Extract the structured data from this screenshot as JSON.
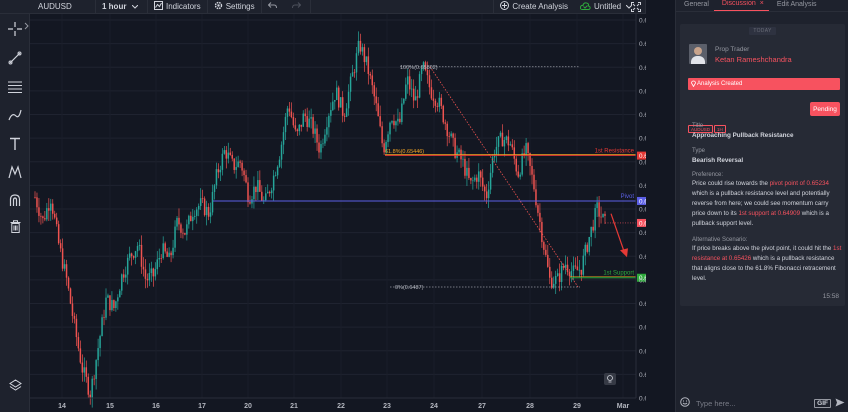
{
  "toolbar": {
    "symbol": "AUDUSD",
    "interval": "1 hour",
    "indicators": "Indicators",
    "settings": "Settings",
    "create_analysis": "Create Analysis",
    "untitled": "Untitled"
  },
  "panel": {
    "tabs": [
      "General",
      "Discussion",
      "Edit Analysis"
    ],
    "active_tab": "Discussion",
    "today": "TODAY",
    "role": "Prop Trader",
    "author": "Ketan Rameshchandra",
    "status_banner": "Analysis Created",
    "tags": [
      "AUDUSD",
      "1H"
    ],
    "status": "Pending",
    "title_label": "Title",
    "title": "Approaching Pullback Resistance",
    "type_label": "Type",
    "type": "Bearish Reversal",
    "preference_label": "Preference:",
    "preference": [
      {
        "t": "Price could rise towards the ",
        "hl": false
      },
      {
        "t": "pivot point of 0.65234",
        "hl": true
      },
      {
        "t": " which is a pullback resistance level and potentially reverse from here; we could see momentum carry price down to its ",
        "hl": false
      },
      {
        "t": "1st support at 0.64909",
        "hl": true
      },
      {
        "t": " which is a pullback support level.",
        "hl": false
      }
    ],
    "alternative_label": "Alternative Scenario:",
    "alternative": [
      {
        "t": "If price breaks above the pivot point, it could hit the ",
        "hl": false
      },
      {
        "t": "1st resistance at 0.65426",
        "hl": true
      },
      {
        "t": " which is a pullback resistance that aligns close to the 61.8% Fibonacci retracement level.",
        "hl": false
      }
    ],
    "time": "15:58",
    "input_placeholder": "Type here...",
    "gif": "GIF"
  },
  "chart_data": {
    "type": "candlestick",
    "symbol": "AUDUSD",
    "interval": "1 hour",
    "x_tick_labels": [
      "14",
      "15",
      "16",
      "17",
      "20",
      "21",
      "22",
      "23",
      "24",
      "27",
      "28",
      "29",
      "Mar"
    ],
    "y_ticks": [
      0.644,
      0.645,
      0.646,
      0.647,
      0.648,
      0.649,
      0.65,
      0.651,
      0.652,
      0.653,
      0.654,
      0.655,
      0.656,
      0.657,
      0.658,
      0.659,
      0.66
    ],
    "ylim": [
      0.644,
      0.66
    ],
    "price_path": [
      0.6525,
      0.6515,
      0.6525,
      0.6505,
      0.649,
      0.647,
      0.6452,
      0.6442,
      0.6462,
      0.6482,
      0.6478,
      0.6492,
      0.65,
      0.6505,
      0.649,
      0.6492,
      0.6503,
      0.6498,
      0.6515,
      0.651,
      0.652,
      0.6522,
      0.6518,
      0.6535,
      0.6545,
      0.6538,
      0.654,
      0.6525,
      0.653,
      0.6522,
      0.6532,
      0.6545,
      0.6565,
      0.655,
      0.656,
      0.6555,
      0.6545,
      0.656,
      0.657,
      0.656,
      0.6575,
      0.659,
      0.658,
      0.6565,
      0.6545,
      0.656,
      0.6555,
      0.6575,
      0.6565,
      0.658,
      0.657,
      0.6565,
      0.6555,
      0.6545,
      0.654,
      0.653,
      0.6535,
      0.6525,
      0.6545,
      0.655,
      0.6548,
      0.6535,
      0.6545,
      0.653,
      0.651,
      0.649,
      0.649,
      0.6497,
      0.6493,
      0.6495,
      0.6508,
      0.652,
      0.6514
    ],
    "levels": [
      {
        "name": "1st Resistance",
        "price": 0.65426,
        "label": "0.65426",
        "color": "#e53935"
      },
      {
        "name": "Pivot",
        "price": 0.65234,
        "label": "0.65234",
        "color": "#5b5fe6"
      },
      {
        "name": "1st Support",
        "price": 0.64909,
        "label": "0.64909",
        "color": "#2eaa3c"
      }
    ],
    "current_price": {
      "price": 0.65141,
      "label": "0.65141",
      "color": "#f7525f"
    },
    "fibonacci": [
      {
        "label": "100%(0.65802)",
        "price": 0.65802
      },
      {
        "label": "61.8%(0.65446)",
        "price": 0.65446
      },
      {
        "label": "0%(0.6487)",
        "price": 0.6487
      }
    ],
    "arrow": {
      "from": 0.6518,
      "to": 0.65,
      "color": "#e53935"
    }
  }
}
